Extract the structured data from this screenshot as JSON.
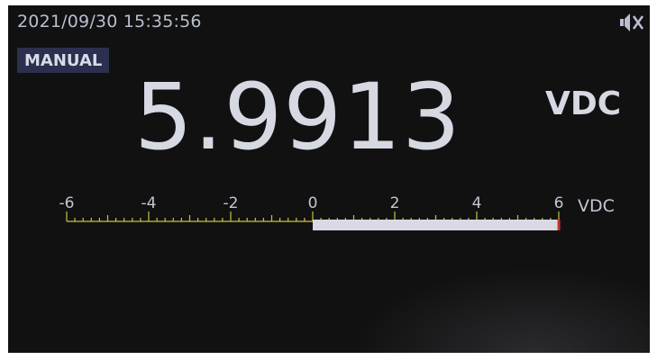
{
  "status": {
    "datetime": "2021/09/30 15:35:56",
    "mute_icon": "speaker-muted-icon"
  },
  "mode": {
    "label": "MANUAL"
  },
  "measurement": {
    "value": "5.9913",
    "unit": "VDC"
  },
  "bargraph": {
    "min": -6,
    "max": 6,
    "value": 5.9913,
    "labels": [
      "-6",
      "-4",
      "-2",
      "0",
      "2",
      "4",
      "6"
    ],
    "unit": "VDC",
    "colors": {
      "scale": "#c9c23a",
      "fill": "#d8d9e4",
      "end_marker": "#c0362c",
      "text": "#c4c7d2"
    }
  }
}
